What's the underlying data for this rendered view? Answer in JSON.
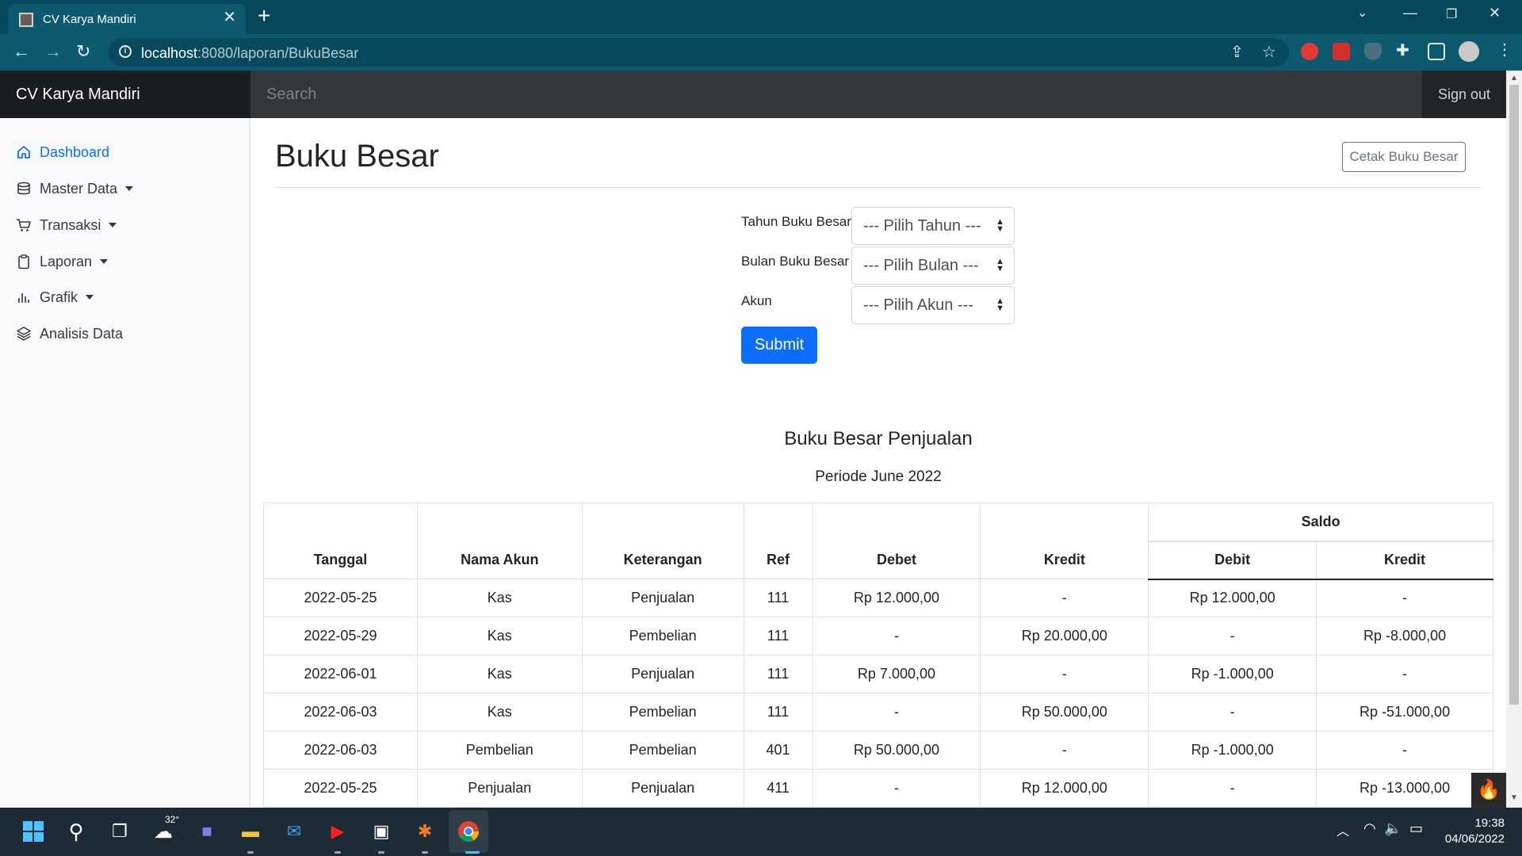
{
  "browser": {
    "tab_title": "CV Karya Mandiri",
    "url_host": "localhost",
    "url_path": ":8080/laporan/BukuBesar"
  },
  "navbar": {
    "brand": "CV Karya Mandiri",
    "search_placeholder": "Search",
    "signout": "Sign out"
  },
  "sidebar": {
    "items": [
      {
        "label": "Dashboard",
        "icon": "home-icon",
        "active": true
      },
      {
        "label": "Master Data",
        "icon": "database-icon",
        "dropdown": true
      },
      {
        "label": "Transaksi",
        "icon": "cart-icon",
        "dropdown": true
      },
      {
        "label": "Laporan",
        "icon": "clipboard-icon",
        "dropdown": true
      },
      {
        "label": "Grafik",
        "icon": "bar-chart-icon",
        "dropdown": true
      },
      {
        "label": "Analisis Data",
        "icon": "layers-icon"
      }
    ]
  },
  "page": {
    "title": "Buku Besar",
    "print_button": "Cetak Buku Besar"
  },
  "form": {
    "year_label": "Tahun Buku Besar",
    "year_value": "--- Pilih Tahun ---",
    "month_label": "Bulan Buku Besar",
    "month_value": "--- Pilih Bulan ---",
    "account_label": "Akun",
    "account_value": "--- Pilih Akun ---",
    "submit": "Submit"
  },
  "report": {
    "title": "Buku Besar Penjualan",
    "period": "Periode June 2022",
    "headers": {
      "tanggal": "Tanggal",
      "nama_akun": "Nama Akun",
      "keterangan": "Keterangan",
      "ref": "Ref",
      "debet": "Debet",
      "kredit": "Kredit",
      "saldo": "Saldo",
      "saldo_debit": "Debit",
      "saldo_kredit": "Kredit"
    },
    "rows": [
      [
        "2022-05-25",
        "Kas",
        "Penjualan",
        "111",
        "Rp 12.000,00",
        "-",
        "Rp 12.000,00",
        "-"
      ],
      [
        "2022-05-29",
        "Kas",
        "Pembelian",
        "111",
        "-",
        "Rp 20.000,00",
        "-",
        "Rp -8.000,00"
      ],
      [
        "2022-06-01",
        "Kas",
        "Penjualan",
        "111",
        "Rp 7.000,00",
        "-",
        "Rp -1.000,00",
        "-"
      ],
      [
        "2022-06-03",
        "Kas",
        "Pembelian",
        "111",
        "-",
        "Rp 50.000,00",
        "-",
        "Rp -51.000,00"
      ],
      [
        "2022-06-03",
        "Pembelian",
        "Pembelian",
        "401",
        "Rp 50.000,00",
        "-",
        "Rp -1.000,00",
        "-"
      ],
      [
        "2022-05-25",
        "Penjualan",
        "Penjualan",
        "411",
        "-",
        "Rp 12.000,00",
        "-",
        "Rp -13.000,00"
      ]
    ]
  },
  "taskbar": {
    "weather": "32°",
    "time": "19:38",
    "date": "04/06/2022"
  },
  "colors": {
    "tabstrip": "#05485c",
    "toolbar": "#0d5a70",
    "navbar": "#212529",
    "primary": "#0d6efd"
  }
}
